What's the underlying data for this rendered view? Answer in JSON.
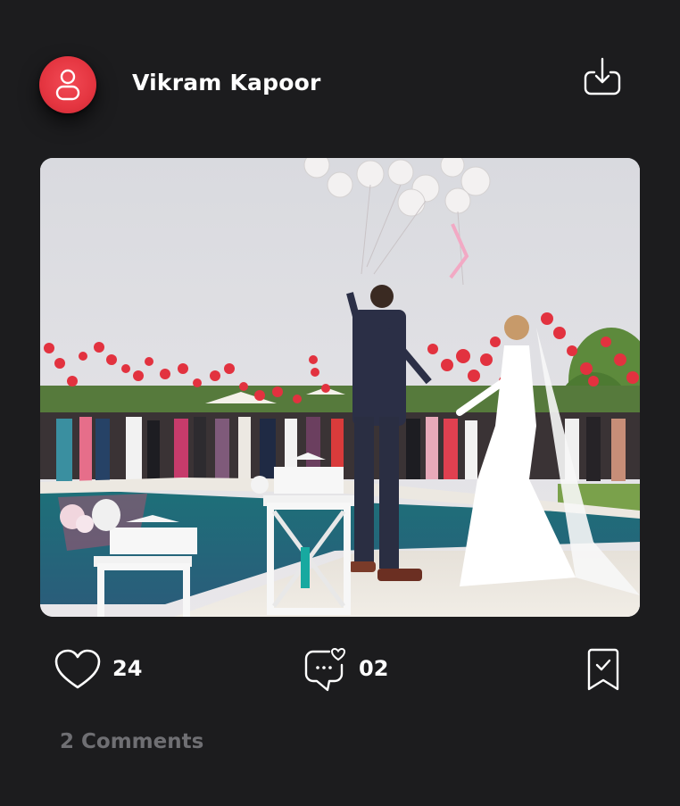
{
  "post": {
    "author": {
      "name": "Vikram Kapoor",
      "avatar_icon": "user-icon",
      "avatar_color": "#e43540"
    },
    "header_action_icon": "download-icon",
    "image_description": "outdoor wedding couple by pool releasing balloons",
    "actions": {
      "like_icon": "heart-icon",
      "like_count": "24",
      "comment_icon": "comment-icon",
      "comment_count": "02",
      "save_icon": "bookmark-check-icon"
    },
    "comments_link": "2 Comments"
  },
  "theme": {
    "background": "#1c1c1e",
    "text": "#ffffff",
    "muted": "#6f6f73",
    "accent": "#e43540"
  }
}
